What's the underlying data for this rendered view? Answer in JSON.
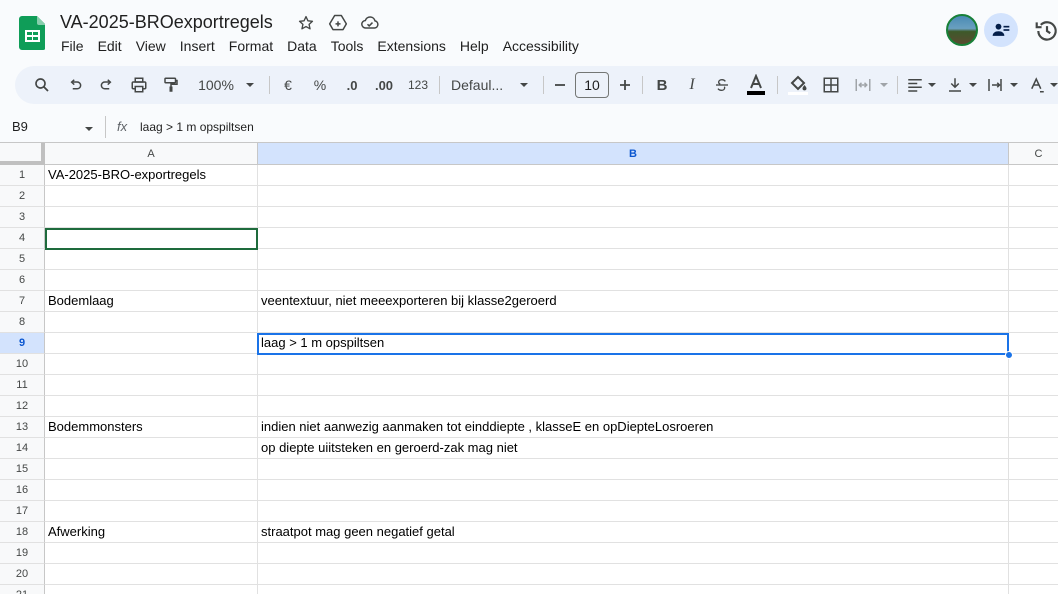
{
  "doc": {
    "title": "VA-2025-BROexportregels"
  },
  "menu": [
    "File",
    "Edit",
    "View",
    "Insert",
    "Format",
    "Data",
    "Tools",
    "Extensions",
    "Help",
    "Accessibility"
  ],
  "toolbar": {
    "zoom": "100%",
    "currency": "€",
    "percent": "%",
    "decrease_decimal": ".0",
    "increase_decimal": ".00",
    "number_format": "123",
    "font": "Defaul...",
    "font_size": "10"
  },
  "formula_bar": {
    "name_box": "B9",
    "fx_label": "fx",
    "value": "laag > 1 m opspiltsen"
  },
  "grid": {
    "columns": [
      "A",
      "B",
      "C"
    ],
    "selected_column": "B",
    "selected_row": "9",
    "rows": [
      {
        "num": "1",
        "a": "VA-2025-BRO-exportregels",
        "b": ""
      },
      {
        "num": "2",
        "a": "",
        "b": ""
      },
      {
        "num": "3",
        "a": "",
        "b": ""
      },
      {
        "num": "4",
        "a": "",
        "b": ""
      },
      {
        "num": "5",
        "a": "",
        "b": ""
      },
      {
        "num": "6",
        "a": "",
        "b": ""
      },
      {
        "num": "7",
        "a": "Bodemlaag",
        "b": "veentextuur, niet meeexporteren  bij klasse2geroerd"
      },
      {
        "num": "8",
        "a": "",
        "b": ""
      },
      {
        "num": "9",
        "a": "",
        "b": "laag > 1 m opspiltsen"
      },
      {
        "num": "10",
        "a": "",
        "b": ""
      },
      {
        "num": "11",
        "a": "",
        "b": ""
      },
      {
        "num": "12",
        "a": "",
        "b": ""
      },
      {
        "num": "13",
        "a": "Bodemmonsters",
        "b": "indien niet aanwezig aanmaken tot einddiepte , klasseE en opDiepteLosroeren"
      },
      {
        "num": "14",
        "a": "",
        "b": "op diepte uiitsteken en geroerd-zak mag niet"
      },
      {
        "num": "15",
        "a": "",
        "b": ""
      },
      {
        "num": "16",
        "a": "",
        "b": ""
      },
      {
        "num": "17",
        "a": "",
        "b": ""
      },
      {
        "num": "18",
        "a": "Afwerking",
        "b": "straatpot mag geen negatief getal"
      },
      {
        "num": "19",
        "a": "",
        "b": ""
      },
      {
        "num": "20",
        "a": "",
        "b": ""
      },
      {
        "num": "21",
        "a": "",
        "b": ""
      }
    ]
  },
  "colors": {
    "accent": "#1a73e8",
    "selection_header": "#d3e3fd",
    "sheets_green": "#0f9d58"
  }
}
